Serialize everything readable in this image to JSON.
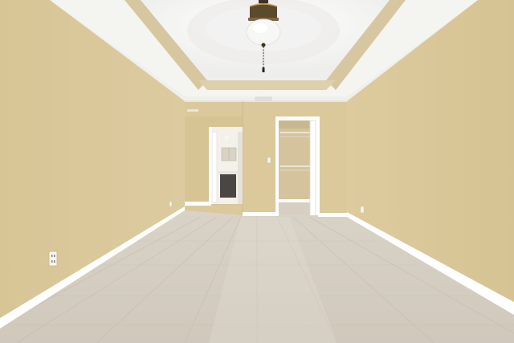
{
  "scene": {
    "subject": "empty-bedroom-interior",
    "colors": {
      "wall": "#dcc99a",
      "wall_shadow": "#cdb98a",
      "ceiling": "#f2f1ee",
      "tray_ceiling": "#f6f6f4",
      "trim": "#d3c29a",
      "baseboard": "#ffffff",
      "floor": "#d8d2c6",
      "floor_dark": "#c9c2b5",
      "doorway_light": "#f4f3ee",
      "closet_interior": "#d7c4a0",
      "fan_canopy": "#5a4a30",
      "fan_globe": "#f7f7f5"
    },
    "icons": [
      "ceiling-fan-light-icon",
      "outlet-icon",
      "light-switch-icon"
    ]
  }
}
